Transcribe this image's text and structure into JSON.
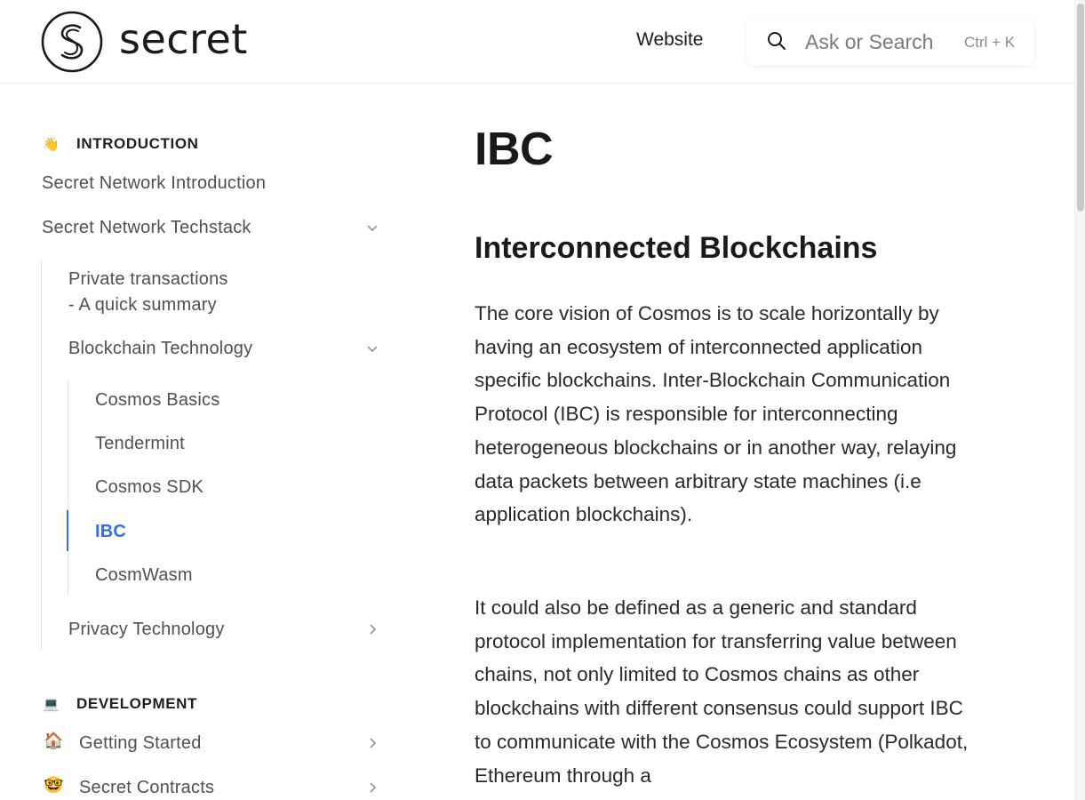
{
  "header": {
    "logo_text": "secret",
    "nav_website": "Website",
    "search_placeholder": "Ask or Search",
    "search_shortcut": "Ctrl + K"
  },
  "sidebar": {
    "introduction": {
      "emoji": "👋",
      "title": "INTRODUCTION",
      "items": [
        "Secret Network Introduction",
        "Secret Network Techstack"
      ],
      "techstack_children": {
        "private_tx_line1": "Private transactions",
        "private_tx_line2": "- A quick summary",
        "blockchain_tech": "Blockchain Technology",
        "blockchain_children": [
          "Cosmos Basics",
          "Tendermint",
          "Cosmos SDK",
          "IBC",
          "CosmWasm"
        ],
        "privacy_tech": "Privacy Technology"
      }
    },
    "development": {
      "emoji": "💻",
      "title": "DEVELOPMENT",
      "items": [
        {
          "emoji": "🏠",
          "label": "Getting Started"
        },
        {
          "emoji": "🤓",
          "label": "Secret Contracts"
        }
      ]
    },
    "active_item": "IBC"
  },
  "content": {
    "title": "IBC",
    "heading": "Interconnected Blockchains",
    "paragraph1": "The core vision of Cosmos is to scale horizontally by having an ecosystem of interconnected application specific blockchains. Inter-Blockchain Communication Protocol (IBC) is responsible for interconnecting heterogeneous blockchains or in another way, relaying data packets between arbitrary state machines (i.e application blockchains).",
    "paragraph2": "It could also be defined as a generic and standard protocol implementation for transferring value between chains, not only limited to Cosmos chains as other blockchains with different consensus could support IBC to communicate with the Cosmos Ecosystem (Polkadot, Ethereum through a"
  },
  "colors": {
    "accent": "#3a6fd8",
    "text": "#1f1f1f",
    "muted": "#505050"
  }
}
